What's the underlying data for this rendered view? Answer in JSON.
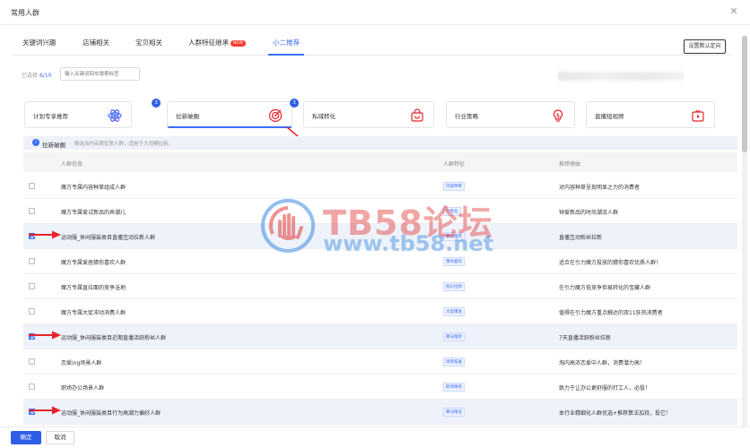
{
  "window": {
    "title": "常用人群"
  },
  "tabs": [
    {
      "label": "关键词兴趣"
    },
    {
      "label": "店铺相关"
    },
    {
      "label": "宝贝相关"
    },
    {
      "label": "人群特征继承",
      "badge": "NEW"
    },
    {
      "label": "小二推荐"
    }
  ],
  "active_tab": "小二推荐",
  "toolbar": {
    "default_button": "设置默认定向"
  },
  "selection": {
    "label": "已选择",
    "count": "6/10"
  },
  "search": {
    "placeholder": "输入关键词回车搜索标签"
  },
  "cards": [
    {
      "label": "计划专享推荐",
      "badge": "3",
      "icon": "atom-icon"
    },
    {
      "label": "拉新破圈",
      "badge": "3",
      "icon": "target-icon"
    },
    {
      "label": "私域转化",
      "icon": "bag-icon"
    },
    {
      "label": "行业策略",
      "icon": "bulb-icon"
    },
    {
      "label": "直播短视频",
      "icon": "video-icon"
    }
  ],
  "info": {
    "title": "拉新破圈",
    "desc": "精选淘内高质优质人群，适用于大规模拉新。"
  },
  "table": {
    "headers": [
      "人群信息",
      "人群特征",
      "推荐理由"
    ],
    "rows": [
      {
        "name": "魔方专属内容种草组成人群",
        "tag": "内容种草",
        "reason": "对内容种草呈现明显之力的消费者",
        "checked": false,
        "arrow": false
      },
      {
        "name": "魔方专属爱试新品的弄潮儿",
        "tag": "个性化",
        "reason": "钟爱新品的时尚潮流人群",
        "checked": false,
        "arrow": false
      },
      {
        "name": "运动服_休闲服装类目直播互动拉新人群",
        "tag": "算法推荐",
        "reason": "直播互动粉丝拉新",
        "checked": true,
        "arrow": true
      },
      {
        "name": "魔方专属爱居猜你喜欢人群",
        "tag": "猜你喜欢",
        "reason": "适合在引力魔方投放的猜你喜欢优质人群！",
        "checked": false,
        "arrow": false
      },
      {
        "name": "魔方专属直拉面的竞争洼地",
        "tag": "低价拉新",
        "reason": "在引力魔方低竞争但易转化的宝藏人群",
        "checked": false,
        "arrow": false
      },
      {
        "name": "魔方专属大促冲动消费人群",
        "tag": "大促爆发",
        "reason": "值得在引力魔方重点触达的双11狂热消费者",
        "checked": false,
        "arrow": false
      },
      {
        "name": "运动服_休闲服装类目近期直播活跃粉丝人群",
        "tag": "算法推荐",
        "reason": "7天直播活跃粉丝拉新",
        "checked": true,
        "arrow": true
      },
      {
        "name": "恋爱ing场景人群",
        "tag": "场景拓展",
        "reason": "淘内高浓恋爱中人群，消费潜力高！",
        "checked": false,
        "arrow": false
      },
      {
        "name": "职场办公场景人群",
        "tag": "职场精英",
        "reason": "致力于让办公更舒服的打工人，必投！",
        "checked": false,
        "arrow": false
      },
      {
        "name": "运动服_休闲服装类目行为高潮力偏好人群",
        "tag": "算法精选",
        "reason": "本行业精细化人群优选+推荐算法加持，投它！",
        "checked": true,
        "arrow": true
      }
    ]
  },
  "footer": {
    "ok": "确定",
    "cancel": "取消"
  },
  "watermark": {
    "brand": "TB58论坛",
    "url": "www.tb58.net"
  },
  "colors": {
    "accent": "#3b6ef5",
    "primary_button": "#2f5ee6",
    "arrow": "#e8222a"
  }
}
